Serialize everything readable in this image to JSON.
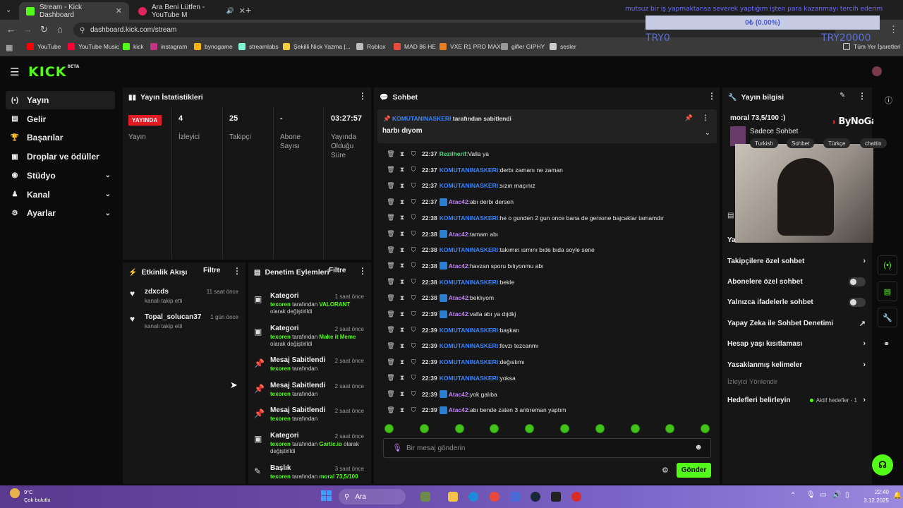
{
  "browser": {
    "tabs": [
      {
        "label": "Stream - Kick Dashboard",
        "favicon_color": "#53fc18"
      },
      {
        "label": "Ara Beni Lütfen - YouTube M",
        "favicon_color": "#e0245e"
      }
    ],
    "url": "dashboard.kick.com/stream",
    "bookmarks": [
      {
        "label": "YouTube",
        "color": "#ff0000"
      },
      {
        "label": "YouTube Music",
        "color": "#ff0033"
      },
      {
        "label": "kick",
        "color": "#53fc18"
      },
      {
        "label": "instagram",
        "color": "#c13584"
      },
      {
        "label": "bynogame",
        "color": "#f7b500"
      },
      {
        "label": "streamlabs",
        "color": "#80f5d2"
      },
      {
        "label": "Şekilli Nick Yazma |...",
        "color": "#f4d03f"
      },
      {
        "label": "Roblox",
        "color": "#bbbbbb"
      },
      {
        "label": "MAD 86 HE",
        "color": "#e74c3c"
      },
      {
        "label": "VXE R1 PRO MAX",
        "color": "#e67e22"
      },
      {
        "label": "gifler GIPHY",
        "color": "#999999"
      },
      {
        "label": "sesler",
        "color": "#cccccc"
      }
    ],
    "all_bookmarks": "Tüm Yer İşaretleri"
  },
  "overlay": {
    "marquee": "mutsuz bir iş yapmaktansa severek yaptığım işten para kazanmayı tercih ederim",
    "goal": "0₺ (0.00%)",
    "left_tag": "TRY0",
    "right_tag": "TRY20000"
  },
  "sidebar": {
    "items": [
      {
        "label": "Yayın",
        "icon": "broadcast-icon",
        "glyph": "(•)"
      },
      {
        "label": "Gelir",
        "icon": "wallet-icon",
        "glyph": "▤"
      },
      {
        "label": "Başarılar",
        "icon": "trophy-icon",
        "glyph": "🏆"
      },
      {
        "label": "Droplar ve ödüller",
        "icon": "gift-icon",
        "glyph": "▣"
      },
      {
        "label": "Stüdyo",
        "icon": "palette-icon",
        "glyph": "◉"
      },
      {
        "label": "Kanal",
        "icon": "user-icon",
        "glyph": "♟"
      },
      {
        "label": "Ayarlar",
        "icon": "gear-icon",
        "glyph": "⚙"
      }
    ]
  },
  "stats": {
    "title": "Yayın İstatistikleri",
    "live": "YAYINDA",
    "stream_label": "Yayın",
    "viewers": {
      "value": "4",
      "label": "İzleyici"
    },
    "followers": {
      "value": "25",
      "label": "Takipçi"
    },
    "subs": {
      "value": "-",
      "label": "Abone Sayısı"
    },
    "uptime": {
      "value": "03:27:57",
      "label": "Yayında Olduğu Süre"
    }
  },
  "activity": {
    "title": "Etkinlik Akışı",
    "filter": "Filtre",
    "items": [
      {
        "name": "zdxcds",
        "sub": "kanalı takip etti",
        "time": "11 saat önce"
      },
      {
        "name": "Topal_solucan37",
        "sub": "kanalı takip etti",
        "time": "1 gün önce"
      }
    ]
  },
  "moderation": {
    "title": "Denetim Eylemleri",
    "filter": "Filtre",
    "items": [
      {
        "title": "Kategori",
        "time": "1 saat önce",
        "user": "texoren",
        "pre": "tarafından",
        "value": "VALORANT",
        "post": "olarak değiştirildi"
      },
      {
        "title": "Kategori",
        "time": "2 saat önce",
        "user": "texoren",
        "pre": "tarafından",
        "value": "Make it Meme",
        "post": "olarak değiştirildi"
      },
      {
        "title": "Mesaj Sabitlendi",
        "time": "2 saat önce",
        "user": "texoren",
        "pre": "tarafından",
        "value": "",
        "post": ""
      },
      {
        "title": "Mesaj Sabitlendi",
        "time": "2 saat önce",
        "user": "texoren",
        "pre": "tarafından",
        "value": "",
        "post": ""
      },
      {
        "title": "Mesaj Sabitlendi",
        "time": "2 saat önce",
        "user": "texoren",
        "pre": "tarafından",
        "value": "",
        "post": ""
      },
      {
        "title": "Kategori",
        "time": "2 saat önce",
        "user": "texoren",
        "pre": "tarafından",
        "value": "Gartic.io",
        "post": "olarak değiştirildi"
      },
      {
        "title": "Başlık",
        "time": "3 saat önce",
        "user": "texoren",
        "pre": "tarafından",
        "value": "moral 73,5/100",
        "post": ""
      }
    ]
  },
  "chat": {
    "title": "Sohbet",
    "pinned_by": "KOMUTANINASKERI",
    "pinned_suffix": "tarafından sabitlendi",
    "pinned_text": "harbı dıyom",
    "messages": [
      {
        "time": "22:37",
        "user": "Rezilherif",
        "color": "#4ade80",
        "badge": false,
        "text": "Valla ya"
      },
      {
        "time": "22:37",
        "user": "KOMUTANINASKERI",
        "color": "#3b82f6",
        "badge": false,
        "text": "derbı zamanı ne zaman"
      },
      {
        "time": "22:37",
        "user": "KOMUTANINASKERI",
        "color": "#3b82f6",
        "badge": false,
        "text": "sızın maçınız"
      },
      {
        "time": "22:37",
        "user": "Atac42",
        "color": "#c084fc",
        "badge": true,
        "text": "abı derbı dersen"
      },
      {
        "time": "22:38",
        "user": "KOMUTANINASKERI",
        "color": "#3b82f6",
        "badge": false,
        "text": "he o gunden 2 gun once bana de gerısıne bajcaklar tamamdır"
      },
      {
        "time": "22:38",
        "user": "Atac42",
        "color": "#c084fc",
        "badge": true,
        "text": "tamam abı"
      },
      {
        "time": "22:38",
        "user": "KOMUTANINASKERI",
        "color": "#3b82f6",
        "badge": false,
        "text": "takımın ısmını bıde bıda soyle sene"
      },
      {
        "time": "22:38",
        "user": "Atac42",
        "color": "#c084fc",
        "badge": true,
        "text": "havzan sporu bılıyonmu abı"
      },
      {
        "time": "22:38",
        "user": "KOMUTANINASKERI",
        "color": "#3b82f6",
        "badge": false,
        "text": "bekle"
      },
      {
        "time": "22:38",
        "user": "Atac42",
        "color": "#c084fc",
        "badge": true,
        "text": "beklıyom"
      },
      {
        "time": "22:39",
        "user": "Atac42",
        "color": "#c084fc",
        "badge": true,
        "text": "valla abı ya dıjdkj"
      },
      {
        "time": "22:39",
        "user": "KOMUTANINASKERI",
        "color": "#3b82f6",
        "badge": false,
        "text": "başkan"
      },
      {
        "time": "22:39",
        "user": "KOMUTANINASKERI",
        "color": "#3b82f6",
        "badge": false,
        "text": "fevzı tezcanmı"
      },
      {
        "time": "22:39",
        "user": "KOMUTANINASKERI",
        "color": "#3b82f6",
        "badge": false,
        "text": "değıstımı"
      },
      {
        "time": "22:39",
        "user": "KOMUTANINASKERI",
        "color": "#3b82f6",
        "badge": false,
        "text": "yoksa"
      },
      {
        "time": "22:39",
        "user": "Atac42",
        "color": "#c084fc",
        "badge": true,
        "text": "yok galıba"
      },
      {
        "time": "22:39",
        "user": "Atac42",
        "color": "#c084fc",
        "badge": true,
        "text": "abı bende zaten 3 antıreman yaptım"
      }
    ],
    "input_placeholder": "Bir mesaj gönderin",
    "send": "Gönder"
  },
  "stream_info": {
    "title": "Yayın bilgisi",
    "stream_title": "moral 73,5/100 :)",
    "category": "Sadece Sohbet",
    "tags": [
      "Turkish",
      "Sohbet",
      "Türkçe",
      "chattin"
    ],
    "sponsor": "ByNoGame",
    "partial_label": "Ya"
  },
  "chat_settings": {
    "items": [
      {
        "label": "Takipçilere özel sohbet",
        "kind": "chevron"
      },
      {
        "label": "Abonelere özel sohbet",
        "kind": "toggle"
      },
      {
        "label": "Yalnızca ifadelerle sohbet",
        "kind": "toggle"
      },
      {
        "label": "Yapay Zeka ile Sohbet Denetimi",
        "kind": "external"
      },
      {
        "label": "Hesap yaşı kısıtlaması",
        "kind": "chevron"
      },
      {
        "label": "Yasaklanmış kelimeler",
        "kind": "chevron"
      }
    ],
    "section": "İzleyici Yönlendir",
    "goals_label": "Hedefleri belirleyin",
    "goals_status": "Aktif hedefler - 1"
  },
  "taskbar": {
    "weather_temp": "9°C",
    "weather_desc": "Çok bulutlu",
    "search": "Ara",
    "time": "22:40",
    "date": "3.12.2025"
  },
  "colors": {
    "accent": "#53fc18",
    "live": "#e01b24"
  }
}
